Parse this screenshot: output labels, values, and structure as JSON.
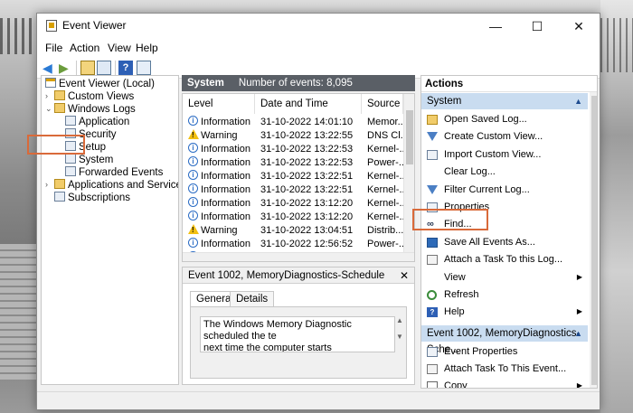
{
  "window": {
    "title": "Event Viewer"
  },
  "menu": [
    "File",
    "Action",
    "View",
    "Help"
  ],
  "tree": {
    "root": "Event Viewer (Local)",
    "custom_views": "Custom Views",
    "windows_logs": "Windows Logs",
    "application": "Application",
    "security": "Security",
    "setup": "Setup",
    "system": "System",
    "forwarded": "Forwarded Events",
    "apps_services": "Applications and Services Lo",
    "subscriptions": "Subscriptions"
  },
  "log": {
    "name": "System",
    "count": "Number of events: 8,095",
    "columns": [
      "Level",
      "Date and Time",
      "Source"
    ],
    "rows": [
      {
        "level": "Information",
        "type": "info",
        "date": "31-10-2022 14:01:10",
        "source": "Memor..."
      },
      {
        "level": "Warning",
        "type": "warn",
        "date": "31-10-2022 13:22:55",
        "source": "DNS Cl..."
      },
      {
        "level": "Information",
        "type": "info",
        "date": "31-10-2022 13:22:53",
        "source": "Kernel-..."
      },
      {
        "level": "Information",
        "type": "info",
        "date": "31-10-2022 13:22:53",
        "source": "Power-..."
      },
      {
        "level": "Information",
        "type": "info",
        "date": "31-10-2022 13:22:51",
        "source": "Kernel-..."
      },
      {
        "level": "Information",
        "type": "info",
        "date": "31-10-2022 13:22:51",
        "source": "Kernel-..."
      },
      {
        "level": "Information",
        "type": "info",
        "date": "31-10-2022 13:12:20",
        "source": "Kernel-..."
      },
      {
        "level": "Information",
        "type": "info",
        "date": "31-10-2022 13:12:20",
        "source": "Kernel-..."
      },
      {
        "level": "Warning",
        "type": "warn",
        "date": "31-10-2022 13:04:51",
        "source": "Distrib..."
      },
      {
        "level": "Information",
        "type": "info",
        "date": "31-10-2022 12:56:52",
        "source": "Power-..."
      },
      {
        "level": "Information",
        "type": "info",
        "date": "31-10-2022 12:56:52",
        "source": "Kernel-..."
      }
    ]
  },
  "detail": {
    "title": "Event 1002, MemoryDiagnostics-Schedule",
    "close": "✕",
    "tab_general": "General",
    "tab_details": "Details",
    "text": "The Windows Memory Diagnostic scheduled the te\nnext time the computer starts"
  },
  "actions": {
    "title": "Actions",
    "section1": "System",
    "items1": [
      "Open Saved Log...",
      "Create Custom View...",
      "Import Custom View...",
      "Clear Log...",
      "Filter Current Log...",
      "Properties",
      "Find...",
      "Save All Events As...",
      "Attach a Task To this Log...",
      "View",
      "Refresh",
      "Help"
    ],
    "section2": "Event 1002, MemoryDiagnostics-Sche...",
    "items2": [
      "Event Properties",
      "Attach Task To This Event...",
      "Copy"
    ]
  },
  "colors": {
    "highlight": "#d96a3a",
    "section_header": "#c9dcf0",
    "log_header": "#5a5f66"
  }
}
